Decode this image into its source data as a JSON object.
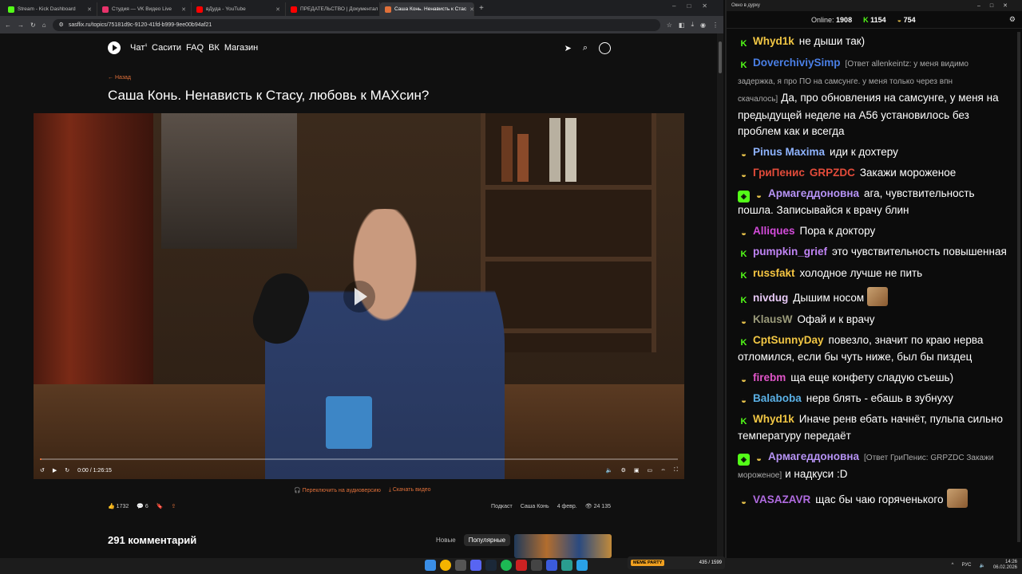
{
  "browser": {
    "tabs": [
      {
        "label": "Stream - Kick Dashboard",
        "color": "#53fc18"
      },
      {
        "label": "Студия — VK Видео Live",
        "color": "#e8336b"
      },
      {
        "label": "вДуда - YouTube",
        "color": "#ff0000"
      },
      {
        "label": "ПРЕДАТЕЛЬСТВО | Документал",
        "color": "#ff0000"
      },
      {
        "label": "Саша Конь. Ненависть к Стас",
        "color": "#e0703a"
      }
    ],
    "url": "sasflix.ru/topics/75181d9c-9120-41fd-b999-9ee00b94af21"
  },
  "site": {
    "nav": {
      "chat": "Чат",
      "chat_badge": "4",
      "sasaciti": "Сасити",
      "faq": "FAQ",
      "vk": "ВК",
      "shop": "Магазин"
    },
    "back": "← Назад",
    "title": "Саша Конь. Ненависть к Стасу, любовь к МАХсин?",
    "player": {
      "time": "0:00 / 1:26:15",
      "progress": 0.003
    },
    "links": {
      "audio": "Переключить на аудиоверсию",
      "download": "Скачать видео"
    },
    "meta": {
      "likes": "1732",
      "comments": "6",
      "tag1": "Подкаст",
      "tag2": "Саша Конь",
      "date": "4 февр.",
      "views": "24 135"
    },
    "comments_title": "291 комментарий",
    "sort": {
      "new": "Новые",
      "popular": "Популярные"
    }
  },
  "chat": {
    "window_title": "Окно в дурку",
    "online_label": "Online:",
    "online": "1908",
    "kick_count": "1154",
    "vk_count": "754",
    "messages": [
      {
        "badges": [
          "kick"
        ],
        "user": "Whyd1k",
        "color": "#f2c744",
        "text": "не дыши так)"
      },
      {
        "badges": [
          "kick"
        ],
        "user": "DoverchiviySimp",
        "color": "#4a7fe5",
        "reply": "[Ответ allenkeintz: у меня видимо задержка, я про ПО на самсунге. у меня только через впн скачалось]",
        "text": "Да, про обновления на самсунге, у меня на предыдущей неделе на А56 установилось без проблем как и всегда"
      },
      {
        "badges": [
          "emote"
        ],
        "user": "Pinus Maxima",
        "color": "#8fb4ff",
        "text": "иди к дохтеру"
      },
      {
        "badges": [
          "emote"
        ],
        "user": "ГриПенис",
        "color": "#e24b3a",
        "user2": "GRPZDC",
        "text": "Закажи мороженое"
      },
      {
        "badges": [
          "shield",
          "emote"
        ],
        "user": "Армагеддоновна",
        "color": "#b693f5",
        "text": "ага, чувствительность пошла. Записывайся к врачу блин"
      },
      {
        "badges": [
          "emote"
        ],
        "user": "Alliques",
        "color": "#d24bd9",
        "text": "Пора к доктору"
      },
      {
        "badges": [
          "kick"
        ],
        "user": "pumpkin_grief",
        "color": "#c084f5",
        "text": "это чувствительность повышенная"
      },
      {
        "badges": [
          "kick"
        ],
        "user": "russfakt",
        "color": "#f5c542",
        "text": "холодное лучше не пить"
      },
      {
        "badges": [
          "kick"
        ],
        "user": "nivdug",
        "color": "#e6c8f5",
        "text": "Дышим носом",
        "emote": true
      },
      {
        "badges": [
          "emote"
        ],
        "user": "KlausW",
        "color": "#9a9a7a",
        "text": "Офай и к врачу"
      },
      {
        "badges": [
          "kick"
        ],
        "user": "CptSunnyDay",
        "color": "#f2c744",
        "text": "повезло, значит по краю нерва отломился, если бы чуть ниже, был бы пиздец"
      },
      {
        "badges": [
          "emote"
        ],
        "user": "firebm",
        "color": "#e055c8",
        "text": "ща еще конфету сладую съешь)"
      },
      {
        "badges": [
          "emote"
        ],
        "user": "Balaboba",
        "color": "#5ab0e5",
        "text": "нерв блять - ебашь в зубнуху"
      },
      {
        "badges": [
          "kick"
        ],
        "user": "Whyd1k",
        "color": "#f2c744",
        "text": "Иначе ренв ебать начнёт, пульпа сильно температуру передаёт"
      },
      {
        "badges": [
          "shield",
          "emote"
        ],
        "user": "Армагеддоновна",
        "color": "#b693f5",
        "reply": "[Ответ ГриПенис: GRPZDC Закажи мороженое]",
        "text": "и надкуси :D"
      },
      {
        "badges": [
          "emote"
        ],
        "user": "VASAZAVR",
        "color": "#b06be0",
        "text": "щас бы чаю горяченького",
        "emote": true
      }
    ]
  },
  "taskbar": {
    "widget_label": "MEME PARTY",
    "widget_value": "435 / 1599",
    "lang": "РУС",
    "time": "14:26",
    "date": "06.02.2026"
  }
}
